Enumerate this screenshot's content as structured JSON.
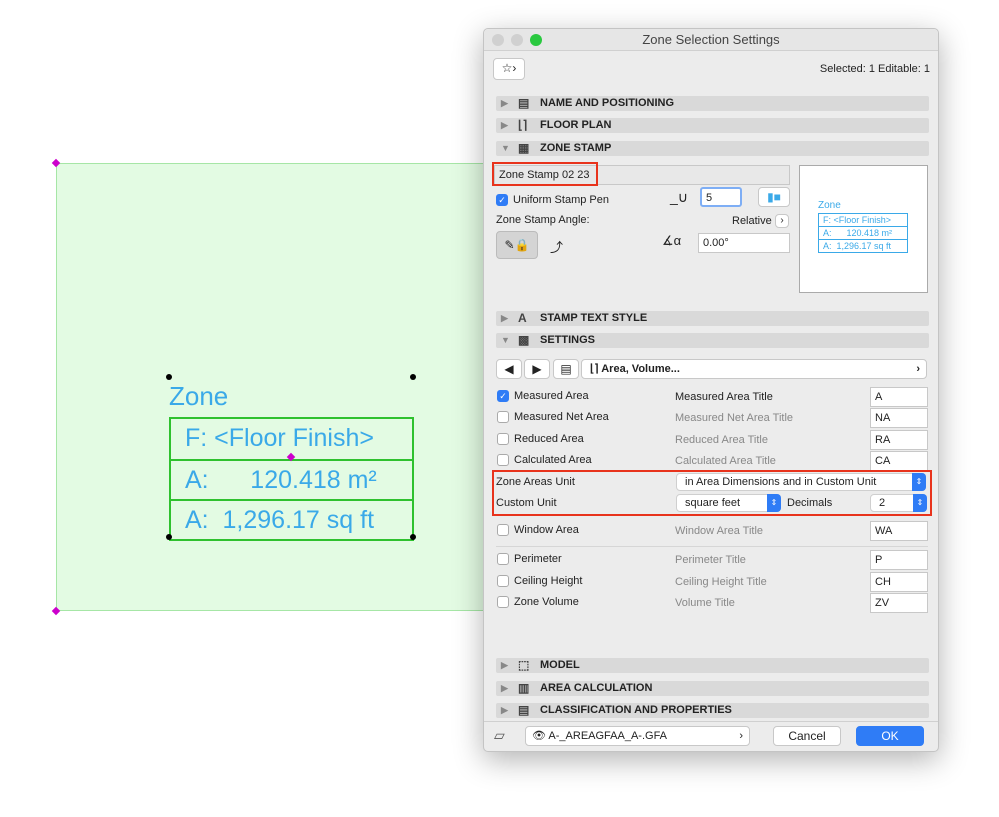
{
  "canvas": {
    "stamp_title": "Zone",
    "rows": [
      "F: <Floor Finish>",
      "A:      120.418 m²",
      "A:  1,296.17 sq ft"
    ]
  },
  "dialog": {
    "title": "Zone Selection Settings",
    "selected_info": "Selected: 1 Editable: 1",
    "sections": {
      "name_positioning": "NAME AND POSITIONING",
      "floor_plan": "FLOOR PLAN",
      "zone_stamp": "ZONE STAMP",
      "stamp_text_style": "STAMP TEXT STYLE",
      "settings": "SETTINGS",
      "model": "MODEL",
      "area_calculation": "AREA CALCULATION",
      "classification": "CLASSIFICATION AND PROPERTIES"
    },
    "zone_stamp": {
      "name": "Zone Stamp 02 23",
      "uniform_pen_label": "Uniform Stamp Pen",
      "uniform_pen_checked": true,
      "pen_value": "5",
      "angle_label": "Zone Stamp Angle:",
      "relative_label": "Relative",
      "angle_value": "0.00°",
      "preview": {
        "title": "Zone",
        "rows": [
          "F: <Floor Finish>",
          "A:      120.418 m²",
          "A:  1,296.17 sq ft"
        ]
      }
    },
    "settings": {
      "panel_label": "Area, Volume...",
      "items": [
        {
          "label": "Measured Area",
          "checked": true,
          "title_label": "Measured Area Title",
          "value": "A",
          "enabled": true
        },
        {
          "label": "Measured Net Area",
          "checked": false,
          "title_label": "Measured Net Area Title",
          "value": "NA",
          "enabled": false
        },
        {
          "label": "Reduced Area",
          "checked": false,
          "title_label": "Reduced Area Title",
          "value": "RA",
          "enabled": false
        },
        {
          "label": "Calculated Area",
          "checked": false,
          "title_label": "Calculated Area Title",
          "value": "CA",
          "enabled": false
        }
      ],
      "zone_areas_unit_label": "Zone Areas Unit",
      "zone_areas_unit_value": "in Area Dimensions and in Custom Unit",
      "custom_unit_label": "Custom Unit",
      "custom_unit_value": "square feet",
      "decimals_label": "Decimals",
      "decimals_value": "2",
      "items2": [
        {
          "label": "Window Area",
          "checked": false,
          "title_label": "Window Area Title",
          "value": "WA"
        },
        {
          "label": "Perimeter",
          "checked": false,
          "title_label": "Perimeter Title",
          "value": "P"
        },
        {
          "label": "Ceiling Height",
          "checked": false,
          "title_label": "Ceiling Height Title",
          "value": "CH"
        },
        {
          "label": "Zone Volume",
          "checked": false,
          "title_label": "Volume Title",
          "value": "ZV"
        }
      ]
    },
    "footer": {
      "layer": "A-_AREAGFAA_A-.GFA",
      "cancel": "Cancel",
      "ok": "OK"
    },
    "colors": {
      "accent": "#2f7cf6",
      "highlight": "#e8331c",
      "stamp_text": "#3aa9e8",
      "stamp_border": "#2fc12f"
    }
  }
}
